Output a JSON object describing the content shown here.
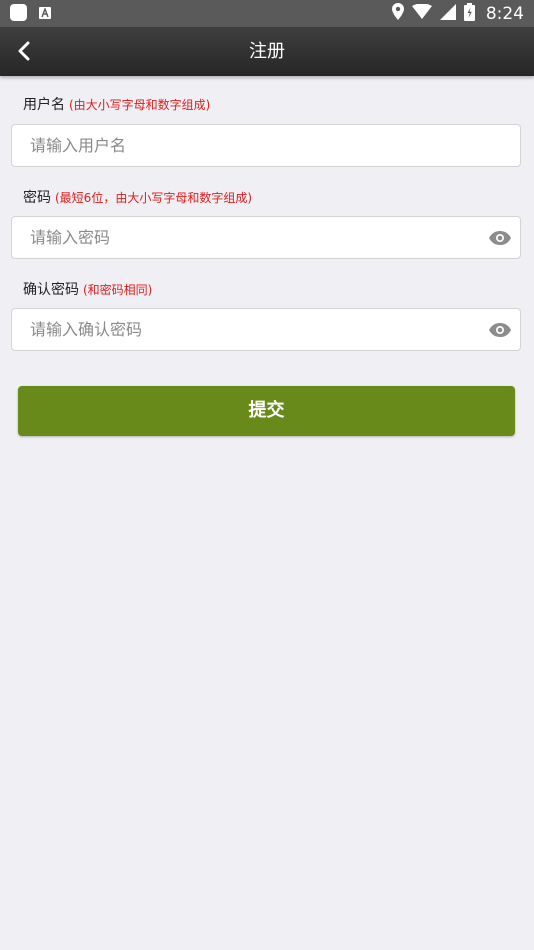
{
  "status_bar": {
    "time": "8:24"
  },
  "app_bar": {
    "title": "注册"
  },
  "form": {
    "username": {
      "label": "用户名",
      "hint": "(由大小写字母和数字组成)",
      "placeholder": "请输入用户名"
    },
    "password": {
      "label": "密码",
      "hint": "(最短6位，由大小写字母和数字组成)",
      "placeholder": "请输入密码"
    },
    "confirm_password": {
      "label": "确认密码",
      "hint": "(和密码相同)",
      "placeholder": "请输入确认密码"
    },
    "submit_label": "提交"
  },
  "colors": {
    "submit": "#688a1b",
    "hint": "#e21c1c",
    "background": "#efeff4"
  }
}
